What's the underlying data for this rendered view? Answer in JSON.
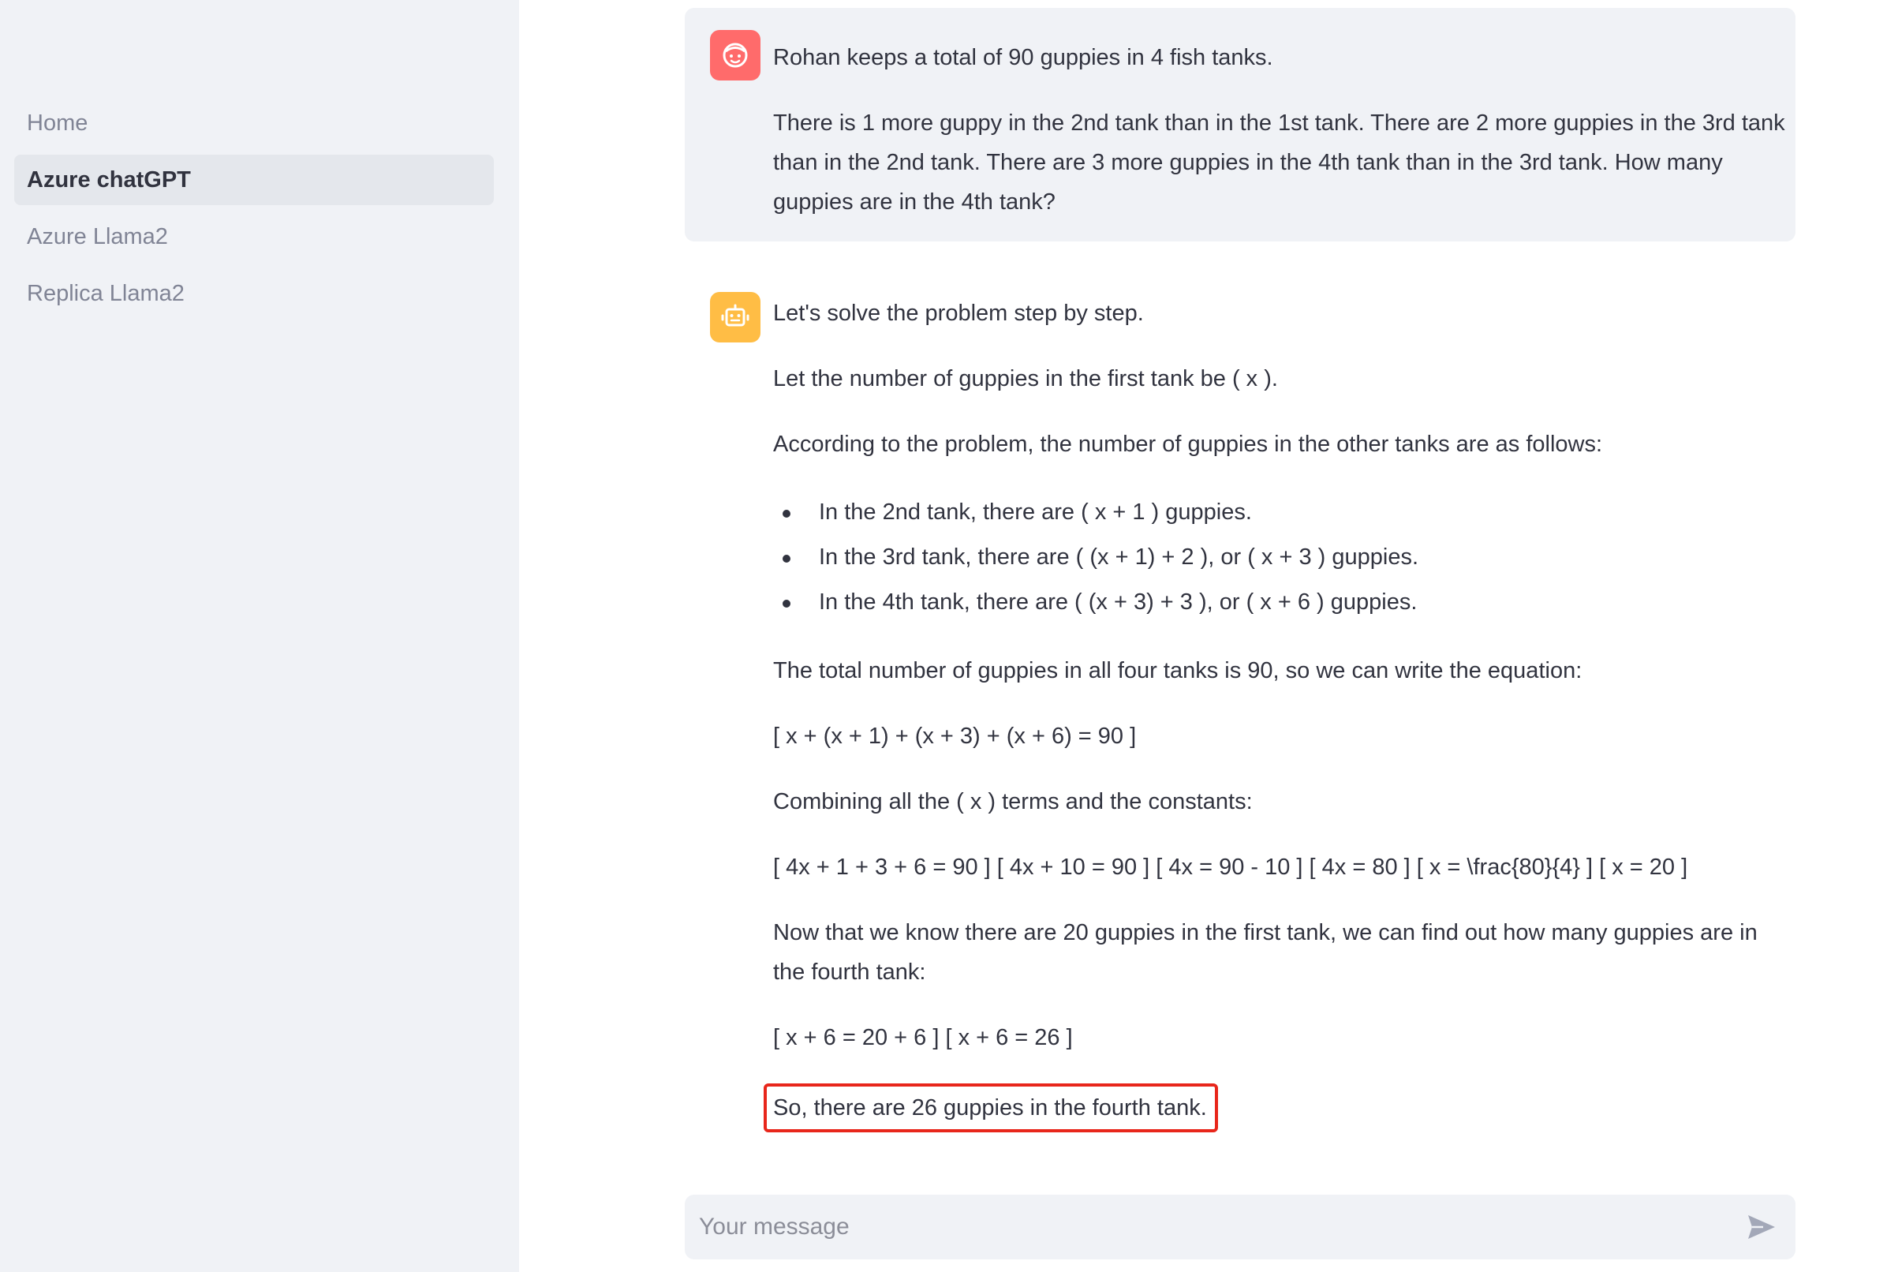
{
  "sidebar": {
    "items": [
      {
        "label": "Home",
        "active": false
      },
      {
        "label": "Azure chatGPT",
        "active": true
      },
      {
        "label": "Azure Llama2",
        "active": false
      },
      {
        "label": "Replica Llama2",
        "active": false
      }
    ]
  },
  "chat": {
    "user_message": {
      "avatar_icon": "face-icon",
      "avatar_color": "#ff6b6b",
      "paragraphs": [
        "Rohan keeps a total of 90 guppies in 4 fish tanks.",
        "There is 1 more guppy in the 2nd tank than in the 1st tank. There are 2 more guppies in the 3rd tank than in the 2nd tank. There are 3 more guppies in the 4th tank than in the 3rd tank. How many guppies are in the 4th tank?"
      ]
    },
    "assistant_message": {
      "avatar_icon": "robot-icon",
      "avatar_color": "#ffbd45",
      "intro": "Let's solve the problem step by step.",
      "let_x": "Let the number of guppies in the first tank be ( x ).",
      "according": "According to the problem, the number of guppies in the other tanks are as follows:",
      "bullets": [
        "In the 2nd tank, there are ( x + 1 ) guppies.",
        "In the 3rd tank, there are ( (x + 1) + 2 ), or ( x + 3 ) guppies.",
        "In the 4th tank, there are ( (x + 3) + 3 ), or ( x + 6 ) guppies."
      ],
      "total_text": "The total number of guppies in all four tanks is 90, so we can write the equation:",
      "equation": "[ x + (x + 1) + (x + 3) + (x + 6) = 90 ]",
      "combining": "Combining all the ( x ) terms and the constants:",
      "steps": "[ 4x + 1 + 3 + 6 = 90 ] [ 4x + 10 = 90 ] [ 4x = 90 - 10 ] [ 4x = 80 ] [ x = \\frac{80}{4} ] [ x = 20 ]",
      "now_text": "Now that we know there are 20 guppies in the first tank, we can find out how many guppies are in the fourth tank:",
      "final_eq": "[ x + 6 = 20 + 6 ] [ x + 6 = 26 ]",
      "answer": "So, there are 26 guppies in the fourth tank.",
      "highlight_color": "#e8261b"
    }
  },
  "input": {
    "placeholder": "Your message",
    "value": "",
    "send_icon": "send-icon"
  }
}
